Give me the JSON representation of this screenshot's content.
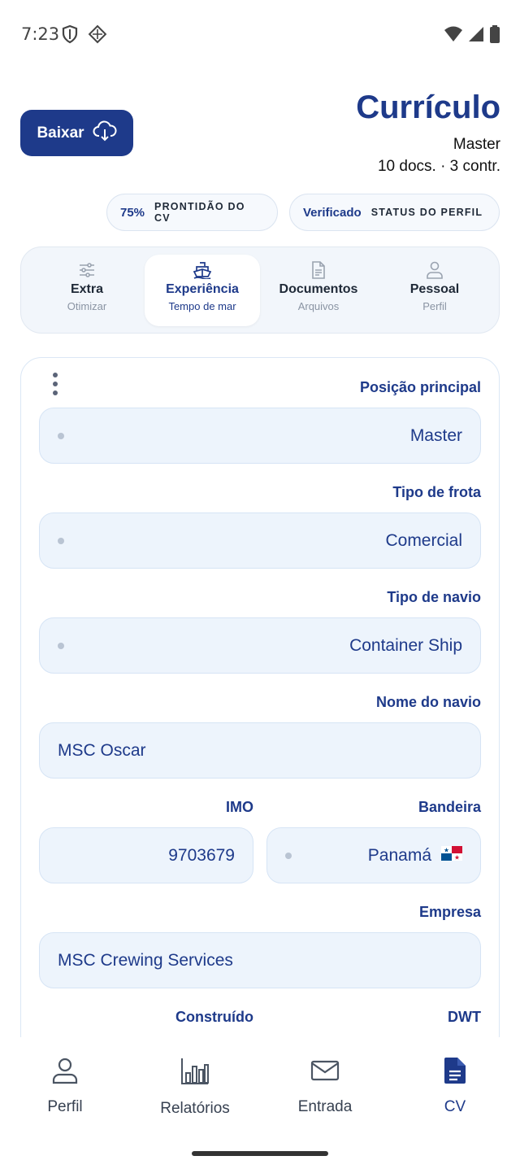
{
  "status_bar": {
    "time": "7:23"
  },
  "header": {
    "download_label": "Baixar",
    "title": "Currículo",
    "position": "Master",
    "meta": "10 docs. · 3 contr."
  },
  "chips": [
    {
      "value": "75%",
      "label": "PRONTIDÃO DO CV"
    },
    {
      "value": "Verificado",
      "label": "STATUS DO PERFIL"
    }
  ],
  "tabs": [
    {
      "label": "Extra",
      "sub": "Otimizar",
      "icon": "sliders-icon"
    },
    {
      "label": "Experiência",
      "sub": "Tempo de mar",
      "icon": "ship-icon",
      "active": true
    },
    {
      "label": "Documentos",
      "sub": "Arquivos",
      "icon": "document-icon"
    },
    {
      "label": "Pessoal",
      "sub": "Perfil",
      "icon": "person-icon"
    }
  ],
  "form": {
    "main_position": {
      "label": "Posição principal",
      "value": "Master"
    },
    "fleet_type": {
      "label": "Tipo de frota",
      "value": "Comercial"
    },
    "vessel_type": {
      "label": "Tipo de navio",
      "value": "Container Ship"
    },
    "vessel_name": {
      "label": "Nome do navio",
      "value": "MSC Oscar"
    },
    "imo": {
      "label": "IMO",
      "value": "9703679"
    },
    "flag": {
      "label": "Bandeira",
      "value": "Panamá",
      "flag_icon": "panama-flag-icon"
    },
    "company": {
      "label": "Empresa",
      "value": "MSC Crewing Services"
    },
    "built": {
      "label": "Construído"
    },
    "dwt": {
      "label": "DWT"
    }
  },
  "bottom_nav": [
    {
      "label": "Perfil",
      "icon": "person-icon"
    },
    {
      "label": "Relatórios",
      "icon": "bar-chart-icon"
    },
    {
      "label": "Entrada",
      "icon": "mail-icon"
    },
    {
      "label": "CV",
      "icon": "document-icon",
      "active": true
    }
  ],
  "colors": {
    "primary": "#1e3a8a",
    "field_bg": "#edf4fc",
    "border": "#d6e4f5"
  }
}
